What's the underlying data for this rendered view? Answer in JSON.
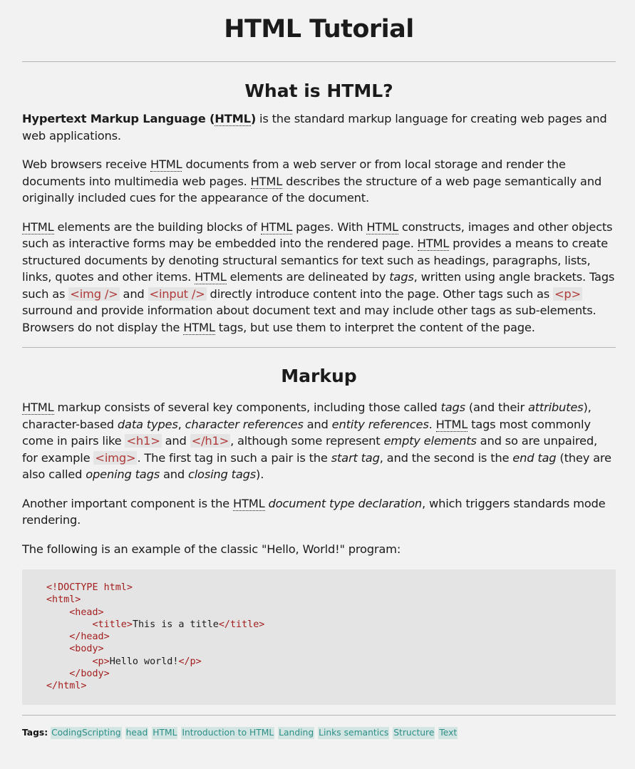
{
  "title": "HTML Tutorial",
  "sections": [
    {
      "heading": "What is HTML?"
    },
    {
      "heading": "Markup"
    }
  ],
  "text": {
    "html": "HTML",
    "p1_strong": "Hypertext Markup Language (",
    "p1_strong_end": ")",
    "p1_rest": " is the standard markup language for creating web pages and web applications.",
    "p2_a": "Web browsers receive ",
    "p2_b": " documents from a web server or from local storage and render the documents into multimedia web pages. ",
    "p2_c": " describes the structure of a web page semantically and originally included cues for the appearance of the document.",
    "p3_a": " elements are the building blocks of ",
    "p3_b": " pages. With ",
    "p3_c": " constructs, images and other objects such as interactive forms may be embedded into the rendered page. ",
    "p3_d": " provides a means to create structured documents by denoting structural semantics for text such as headings, paragraphs, lists, links, quotes and other items. ",
    "p3_e": " elements are delineated by ",
    "p3_tags": "tags",
    "p3_f": ", written using angle brackets. Tags such as ",
    "code_img_self": "<img />",
    "p3_and": " and ",
    "code_input": "<input />",
    "p3_g": " directly introduce content into the page. Other tags such as ",
    "code_p": "<p>",
    "p3_h": " surround and provide information about document text and may include other tags as sub-elements. Browsers do not display the ",
    "p3_i": " tags, but use them to interpret the content of the page.",
    "p4_a": " markup consists of several key components, including those called ",
    "p4_tags": "tags",
    "p4_b": " (and their ",
    "p4_attributes": "attributes",
    "p4_c": "), character-based ",
    "p4_datatypes": "data types",
    "p4_comma": ", ",
    "p4_charrefs": "character references",
    "p4_and": " and ",
    "p4_entityrefs": "entity references",
    "p4_d": ". ",
    "p4_e": " tags most commonly come in pairs like ",
    "code_h1": "<h1>",
    "p4_f": " and ",
    "code_h1_close": "</h1>",
    "p4_g": ", although some represent ",
    "p4_empty": "empty elements",
    "p4_h": " and so are unpaired, for example ",
    "code_img": "<img>",
    "p4_i": ". The first tag in such a pair is the ",
    "p4_start": "start tag",
    "p4_j": ", and the second is the ",
    "p4_end": "end tag",
    "p4_k": " (they are also called ",
    "p4_opening": "opening tags",
    "p4_l": " and ",
    "p4_closing": "closing tags",
    "p4_m": ").",
    "p5_a": "Another important component is the ",
    "p5_doctype": "document type declaration",
    "p5_b": ", which triggers standards mode rendering.",
    "p6": "The following is an example of the classic \"Hello, World!\" program:"
  },
  "code_block": {
    "doctype": "<!DOCTYPE html>",
    "html_open": "<html>",
    "head_open": "<head>",
    "title_open": "<title>",
    "title_text": "This is a title",
    "title_close": "</title>",
    "head_close": "</head>",
    "body_open": "<body>",
    "p_open": "<p>",
    "p_text": "Hello world!",
    "p_close": "</p>",
    "body_close": "</body>",
    "html_close": "</html>"
  },
  "tags_label": "Tags:",
  "tags": [
    "CodingScripting",
    "head",
    "HTML",
    "Introduction to HTML",
    "Landing",
    "Links semantics",
    "Structure",
    "Text"
  ],
  "colors": {
    "background": "#f2f2f2",
    "code_background": "#e4e4e4",
    "code_tag": "#a41d1d",
    "tag_link_bg": "#d3e5e3",
    "tag_link_text": "#2c8f86"
  }
}
